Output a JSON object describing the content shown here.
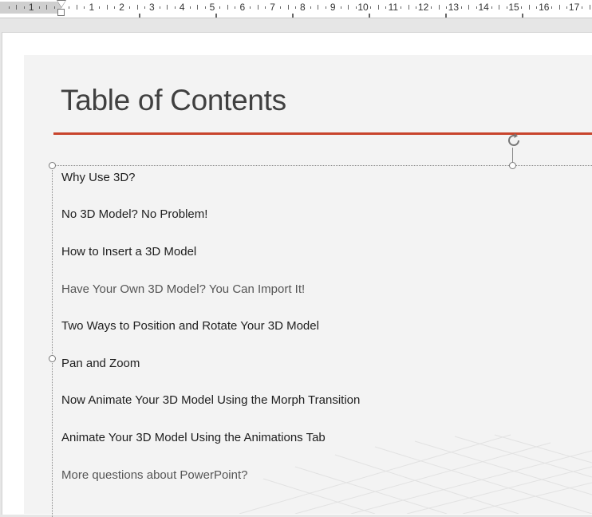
{
  "ruler": {
    "labels": [
      "1",
      "1",
      "2",
      "3",
      "4",
      "5",
      "6",
      "7",
      "8",
      "9",
      "10",
      "11",
      "12",
      "13",
      "14",
      "15",
      "16",
      "17"
    ]
  },
  "slide": {
    "title": "Table of Contents",
    "accent_color": "#c8442c",
    "items": [
      "Why Use 3D?",
      "No 3D Model? No Problem!",
      "How to Insert a 3D Model",
      "Have Your Own 3D Model? You Can Import It!",
      "Two Ways to Position and Rotate Your 3D Model",
      "Pan and Zoom",
      "Now Animate Your 3D Model Using the Morph Transition",
      "Animate Your 3D Model Using the Animations Tab",
      "More questions about PowerPoint?"
    ]
  }
}
